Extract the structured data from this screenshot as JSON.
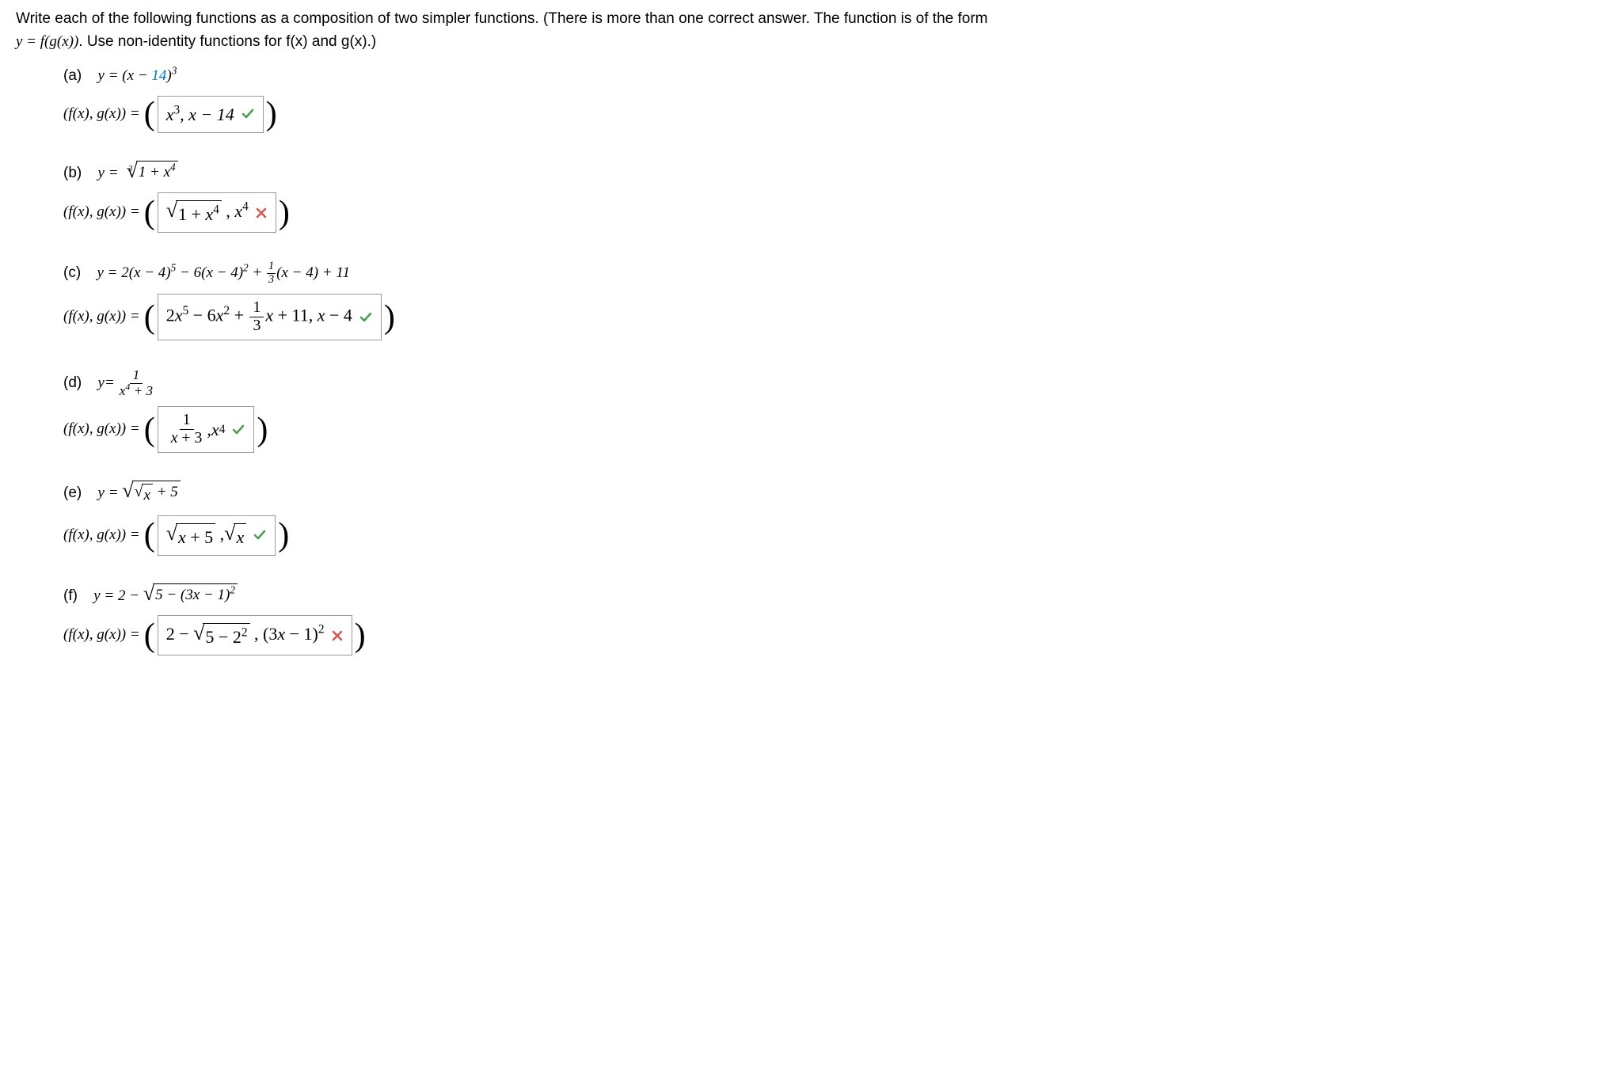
{
  "instructions": {
    "line1": "Write each of the following functions as a composition of two simpler functions. (There is more than one correct answer. The function is of the form",
    "line2_prefix": "y = f(g(x))",
    "line2_suffix": ". Use non-identity functions for f(x) and g(x).)"
  },
  "labels": {
    "answer_prefix": "(f(x), g(x)) = ",
    "parts": {
      "a": "(a)",
      "b": "(b)",
      "c": "(c)",
      "d": "(d)",
      "e": "(e)",
      "f": "(f)"
    }
  },
  "problems": {
    "a": {
      "question_prefix": "y = (x − ",
      "question_num": "14",
      "question_suffix": ")³",
      "answer_f": "x³",
      "answer_g": ", x − 14",
      "status": "correct"
    },
    "b": {
      "question_prefix": "y = ",
      "question_radicand": "1 + x⁴",
      "answer_radicand": "1 + x⁴",
      "answer_g": ", x⁴",
      "status": "incorrect"
    },
    "c": {
      "question_text_pre": "y = 2(x − 4)⁵ − 6(x − 4)² + ",
      "question_text_post": "(x − 4) + 11",
      "answer_f_pre": "2x⁵ − 6x² + ",
      "answer_f_post": "x + 11",
      "answer_g": ", x − 4",
      "status": "correct"
    },
    "d": {
      "question_prefix": "y = ",
      "question_num": "1",
      "question_den": "x⁴ + 3",
      "answer_f_num": "1",
      "answer_f_den": "x + 3",
      "answer_g": ", x⁴",
      "status": "correct"
    },
    "e": {
      "question_prefix": "y = ",
      "question_inner": "x",
      "question_outer_suffix": " + 5",
      "answer_f_radicand": "x + 5",
      "answer_g_radicand": "x",
      "status": "correct"
    },
    "f": {
      "question_prefix": "y = 2 − ",
      "question_radicand": "5 − (3x − 1)²",
      "answer_f_pre": "2 − ",
      "answer_f_radicand": "5 − 2²",
      "answer_g": ", (3x − 1)²",
      "status": "incorrect"
    }
  }
}
